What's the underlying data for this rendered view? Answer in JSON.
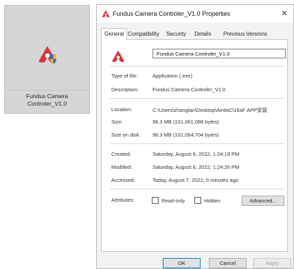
{
  "desktop": {
    "icon_name": "app-logo-shield-icon",
    "label_line1": "Fundus Camera",
    "label_line2": "Controler_V1.0"
  },
  "dialog": {
    "title": "Fundus Camera Controler_V1.0 Properties",
    "close_glyph": "✕",
    "tabs": [
      {
        "label": "General",
        "active": true
      },
      {
        "label": "Compatibility",
        "active": false
      },
      {
        "label": "Security",
        "active": false
      },
      {
        "label": "Details",
        "active": false
      },
      {
        "label": "Previous Versions",
        "active": false
      }
    ],
    "file_name": "Fundus Camera Controler_V1.0",
    "fields": {
      "type_label": "Type of file:",
      "type_value": "Application (.exe)",
      "description_label": "Description:",
      "description_value": "Fundus Camera Controler_V1.0",
      "location_label": "Location:",
      "location_value": "C:\\Users\\zhanglan\\Desktop\\AirdoC\\16aF APP安装",
      "size_label": "Size:",
      "size_value": "96.3 MB (101,061,088 bytes)",
      "size_on_disk_label": "Size on disk:",
      "size_on_disk_value": "96.3 MB (101,064,704 bytes)",
      "created_label": "Created:",
      "created_value": "Saturday, August 6, 2022, 1:24:18 PM",
      "modified_label": "Modified:",
      "modified_value": "Saturday, August 6, 2022, 1:24:26 PM",
      "accessed_label": "Accessed:",
      "accessed_value": "Today, August 7, 2022, 5 minutes ago",
      "attributes_label": "Attributes:"
    },
    "attributes": {
      "readonly_label": "Read-only",
      "hidden_label": "Hidden",
      "advanced_label": "Advanced..."
    },
    "buttons": {
      "ok": "OK",
      "cancel": "Cancel",
      "apply": "Apply"
    }
  },
  "colors": {
    "logo_red": "#e0303c",
    "shield_blue": "#2a6fdb",
    "shield_yellow": "#f2b705",
    "accent": "#0078d7"
  }
}
